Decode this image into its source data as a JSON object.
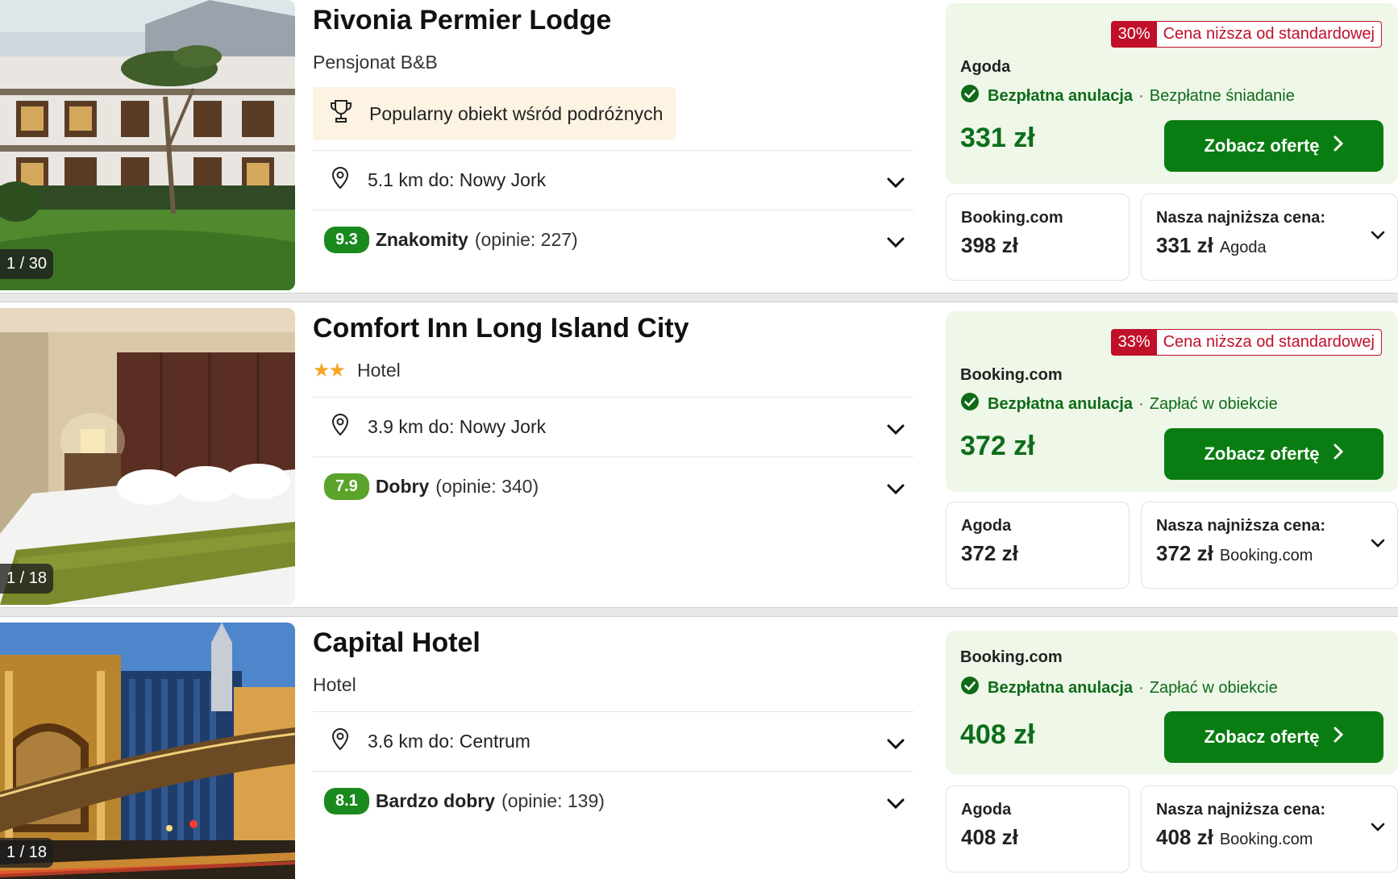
{
  "hotels": [
    {
      "name": "Rivonia Permier Lodge",
      "type": "Pensjonat B&B",
      "stars": "",
      "popular_badge": "Popularny obiekt wśród podróżnych",
      "photo_counter": "1 / 30",
      "distance": "5.1 km do: Nowy Jork",
      "score": "9.3",
      "rating_word": "Znakomity",
      "rating_count": "(opinie: 227)",
      "discount_pct": "30%",
      "discount_text": "Cena niższa od standardowej",
      "deal_provider": "Agoda",
      "free_cancel": "Bezpłatna anulacja",
      "extra_feature": "Bezpłatne śniadanie",
      "deal_price": "331 zł",
      "offer_button": "Zobacz ofertę",
      "alt_provider": "Booking.com",
      "alt_price": "398 zł",
      "lowest_label": "Nasza najniższa cena:",
      "lowest_price": "331 zł",
      "lowest_provider": "Agoda"
    },
    {
      "name": "Comfort Inn Long Island City",
      "type": "Hotel",
      "stars": "★★",
      "popular_badge": "",
      "photo_counter": "1 / 18",
      "distance": "3.9 km do: Nowy Jork",
      "score": "7.9",
      "rating_word": "Dobry",
      "rating_count": "(opinie: 340)",
      "discount_pct": "33%",
      "discount_text": "Cena niższa od standardowej",
      "deal_provider": "Booking.com",
      "free_cancel": "Bezpłatna anulacja",
      "extra_feature": "Zapłać w obiekcie",
      "deal_price": "372 zł",
      "offer_button": "Zobacz ofertę",
      "alt_provider": "Agoda",
      "alt_price": "372 zł",
      "lowest_label": "Nasza najniższa cena:",
      "lowest_price": "372 zł",
      "lowest_provider": "Booking.com"
    },
    {
      "name": "Capital Hotel",
      "type": "Hotel",
      "stars": "",
      "popular_badge": "",
      "photo_counter": "1 / 18",
      "distance": "3.6 km do: Centrum",
      "score": "8.1",
      "rating_word": "Bardzo dobry",
      "rating_count": "(opinie: 139)",
      "discount_pct": "",
      "discount_text": "",
      "deal_provider": "Booking.com",
      "free_cancel": "Bezpłatna anulacja",
      "extra_feature": "Zapłać w obiekcie",
      "deal_price": "408 zł",
      "offer_button": "Zobacz ofertę",
      "alt_provider": "Agoda",
      "alt_price": "408 zł",
      "lowest_label": "Nasza najniższa cena:",
      "lowest_price": "408 zł",
      "lowest_provider": "Booking.com"
    }
  ],
  "icons": [
    "trophy-icon",
    "map-pin-icon",
    "chevron-down-icon",
    "check-circle-icon",
    "chevron-right-icon",
    "star-icon"
  ],
  "colors": {
    "deal_bg": "#eef7e8",
    "offer_button": "#0a7d12",
    "price_green": "#0d6d1a",
    "discount_red": "#c0102a",
    "score_green": "#1a8a1e",
    "score_light_green": "#5ba32b",
    "badge_bg": "#fdf3e3",
    "star": "#f5a623"
  }
}
